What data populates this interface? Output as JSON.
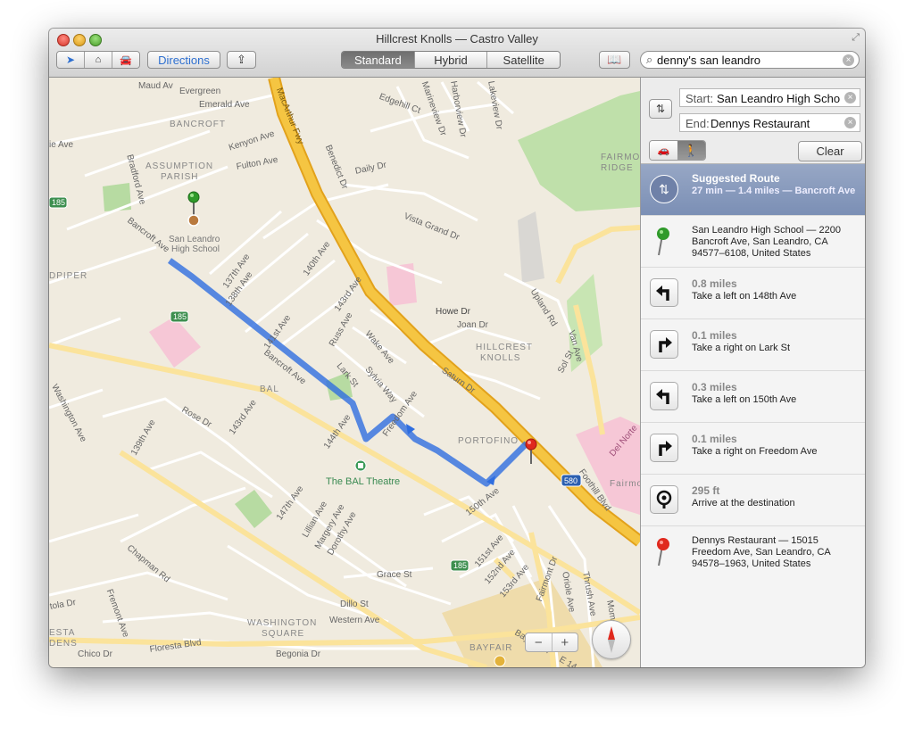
{
  "window": {
    "title": "Hillcrest Knolls — Castro Valley"
  },
  "toolbar": {
    "directions_label": "Directions",
    "map_types": [
      "Standard",
      "Hybrid",
      "Satellite"
    ],
    "active_map_type": "Standard",
    "search_value": "denny's san leandro"
  },
  "map": {
    "labels": {
      "bancroft_area": "BANCROFT",
      "assumption_parish_1": "ASSUMPTION",
      "assumption_parish_2": "PARISH",
      "fairmont_ridge_1": "FAIRMONT",
      "fairmont_ridge_2": "RIDGE",
      "hillcrest_knolls_1": "HILLCREST",
      "hillcrest_knolls_2": "KNOLLS",
      "portofino": "PORTOFINO",
      "bal": "BAL",
      "washington_square_1": "WASHINGTON",
      "washington_square_2": "SQUARE",
      "bayfair": "BAYFAIR",
      "dpiper": "DPIPER",
      "esta": "ESTA",
      "dens": "DENS",
      "fairmont_place": "Fairmo",
      "school_1": "San Leandro",
      "school_2": "High School",
      "theatre": "The BAL Theatre",
      "maud_ave": "Maud Av",
      "evergreen_ave": "Evergreen",
      "emerald_ave": "Emerald Ave",
      "edgehill_ct": "Edgehill Ct",
      "marineview_dr": "Marineview Dr",
      "harborview_dr": "Harborview Dr",
      "lakeview_dr": "Lakeview Dr",
      "kenyon_ave": "Kenyon Ave",
      "fulton_ave": "Fulton Ave",
      "ie_ave": "ie Ave",
      "daily_dr": "Daily Dr",
      "bradford_ave": "Bradford Ave",
      "bancroft_ave_1": "Bancroft Ave",
      "bancroft_ave_2": "Bancroft Ave",
      "macarthur_fwy": "MacArthur Fwy",
      "benedict_dr": "Benedict Dr",
      "vista_grand_dr": "Vista Grand Dr",
      "howe_dr": "Howe Dr",
      "joan_dr": "Joan Dr",
      "upland_rd": "Upland Rd",
      "van_ave": "Van Ave",
      "sol_st": "Sol St",
      "saturn_dr": "Saturn Dr",
      "ave_137th": "137th Ave",
      "ave_138th": "138th Ave",
      "ave_140th": "140th Ave",
      "ave_141st": "141st Ave",
      "ave_143rd_a": "143rd Ave",
      "ave_143rd_b": "143rd Ave",
      "ave_139th": "139th Ave",
      "ave_144th": "144th Ave",
      "ave_147th": "147th Ave",
      "ave_150th": "150th Ave",
      "ave_151st": "151st Ave",
      "ave_152nd": "152nd Ave",
      "ave_153rd": "153rd Ave",
      "russ_ave": "Russ Ave",
      "wake_ave": "Wake Ave",
      "lark_st": "Lark St",
      "sylvia_way": "Sylvia Way",
      "freedom_ave": "Freedom Ave",
      "rose_dr": "Rose Dr",
      "washington_ave": "Washington Ave",
      "lillian_ave": "Lillian Ave",
      "margery_ave": "Margery Ave",
      "dorothy_ave": "Dorothy Ave",
      "grace_st": "Grace St",
      "dillo_st": "Dillo St",
      "western_ave": "Western Ave",
      "begonia_dr": "Begonia Dr",
      "floresta_blvd": "Floresta Blvd",
      "chico_dr": "Chico Dr",
      "tola_dr": "tola Dr",
      "fremont_ave": "Fremont Ave",
      "chapman_rd": "Chapman Rd",
      "fairmont_dr": "Fairmont Dr",
      "oriole_ave": "Oriole Ave",
      "thrush_ave": "Thrush Ave",
      "momo": "Momo",
      "bayfair_dr": "Bayfair Dr",
      "foothill_blvd": "Foothill Blvd",
      "del_norte": "Del Norte",
      "e14": "E 14",
      "hwy185": "185",
      "hwy580": "580"
    }
  },
  "directions": {
    "start_label": "Start:",
    "start_value": "San Leandro High Scho",
    "end_label": "End:",
    "end_value": "Dennys Restaurant",
    "clear_label": "Clear",
    "suggested": {
      "title": "Suggested Route",
      "summary": "27 min — 1.4 miles — Bancroft Ave"
    },
    "start_address": "San Leandro High School — 2200 Bancroft Ave, San Leandro, CA 94577–6108, United States",
    "steps": [
      {
        "distance": "0.8 miles",
        "instruction": "Take a left on 148th Ave",
        "icon": "turn-left-icon"
      },
      {
        "distance": "0.1 miles",
        "instruction": "Take a right on Lark St",
        "icon": "turn-right-icon"
      },
      {
        "distance": "0.3 miles",
        "instruction": "Take a left on 150th Ave",
        "icon": "turn-left-icon"
      },
      {
        "distance": "0.1 miles",
        "instruction": "Take a right on Freedom Ave",
        "icon": "turn-right-icon"
      },
      {
        "distance": "295 ft",
        "instruction": "Arrive at the destination",
        "icon": "arrive-icon"
      }
    ],
    "end_address": "Dennys Restaurant — 15015 Freedom Ave, San Leandro, CA 94578–1963, United States"
  },
  "colors": {
    "route": "#4a8fe8",
    "freeway": "#f5c542",
    "park": "#b7dba2",
    "selection": "#8797bd"
  }
}
